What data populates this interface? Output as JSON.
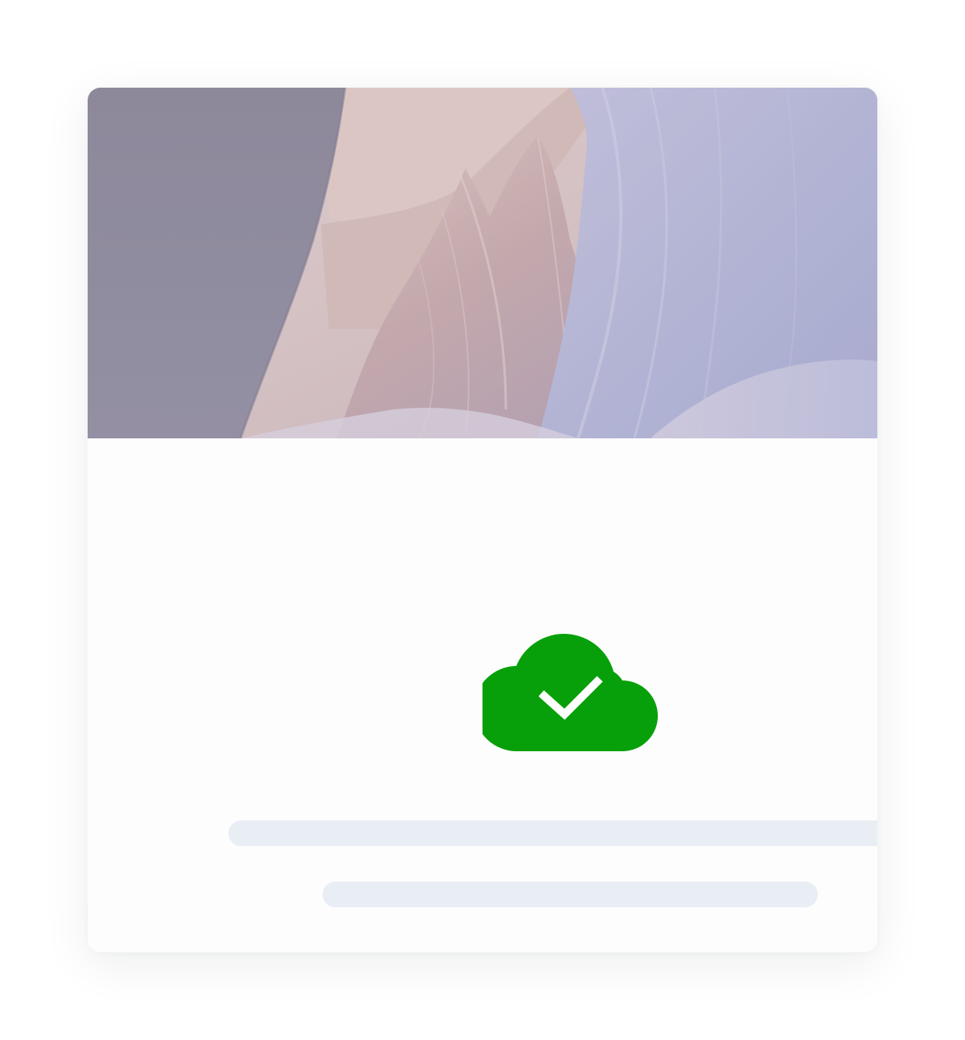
{
  "hero_image": {
    "icon": "canyon-photo",
    "colors": {
      "shadow_rock": "#8e8a99",
      "warm_rock": "#d9bdb7",
      "cool_rock": "#b6b8d8"
    }
  },
  "status": {
    "icon": "cloud-check-icon",
    "color": "#07a00a",
    "check_color": "#ffffff"
  },
  "placeholder": {
    "color": "#e9eef5",
    "line_count": 2
  }
}
